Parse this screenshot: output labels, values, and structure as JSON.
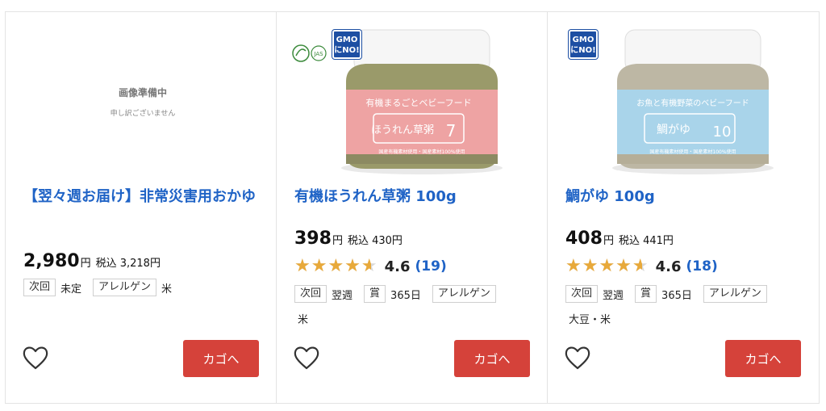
{
  "products": [
    {
      "image_placeholder": {
        "line1": "画像準備中",
        "line2": "申し訳ございません"
      },
      "title": "【翌々週お届け】非常災害用おかゆ",
      "price": "2,980",
      "yen": "円",
      "tax": "税込 3,218円",
      "tags": [
        {
          "label": "次回",
          "value": "未定"
        },
        {
          "label": "アレルゲン",
          "value": "米"
        }
      ],
      "cart_label": "カゴへ"
    },
    {
      "badges": {
        "gmo": [
          "GMO",
          "にNO!"
        ],
        "jas": "JAS"
      },
      "jar_label": {
        "brand": "有機まるごとベビーフード",
        "name": "ほうれん草粥",
        "age": "7",
        "footer": "国産有機素材使用・国産素材100%使用"
      },
      "title": "有機ほうれん草粥 100g",
      "price": "398",
      "yen": "円",
      "tax": "税込 430円",
      "rating": {
        "score": "4.6",
        "count": "(19)",
        "value": 4.6
      },
      "tags": [
        {
          "label": "次回",
          "value": "翌週"
        },
        {
          "label": "賞",
          "value": "365日"
        },
        {
          "label": "アレルゲン",
          "value": "米"
        }
      ],
      "cart_label": "カゴへ"
    },
    {
      "badges": {
        "gmo": [
          "GMO",
          "にNO!"
        ]
      },
      "jar_label": {
        "brand": "お魚と有機野菜のベビーフード",
        "name": "鯛がゆ",
        "age": "10",
        "footer": "国産有機素材使用・国産素材100%使用"
      },
      "title": "鯛がゆ 100g",
      "price": "408",
      "yen": "円",
      "tax": "税込 441円",
      "rating": {
        "score": "4.6",
        "count": "(18)",
        "value": 4.6
      },
      "tags": [
        {
          "label": "次回",
          "value": "翌週"
        },
        {
          "label": "賞",
          "value": "365日"
        },
        {
          "label": "アレルゲン",
          "value": "大豆・米"
        }
      ],
      "cart_label": "カゴへ"
    }
  ],
  "colors": {
    "link": "#1f63c6",
    "cart": "#d5423a",
    "star": "#e8a93a",
    "gmo": "#1d4fa3"
  },
  "icons": {
    "favorite": "heart-outline-icon",
    "rating": "star-icon"
  }
}
